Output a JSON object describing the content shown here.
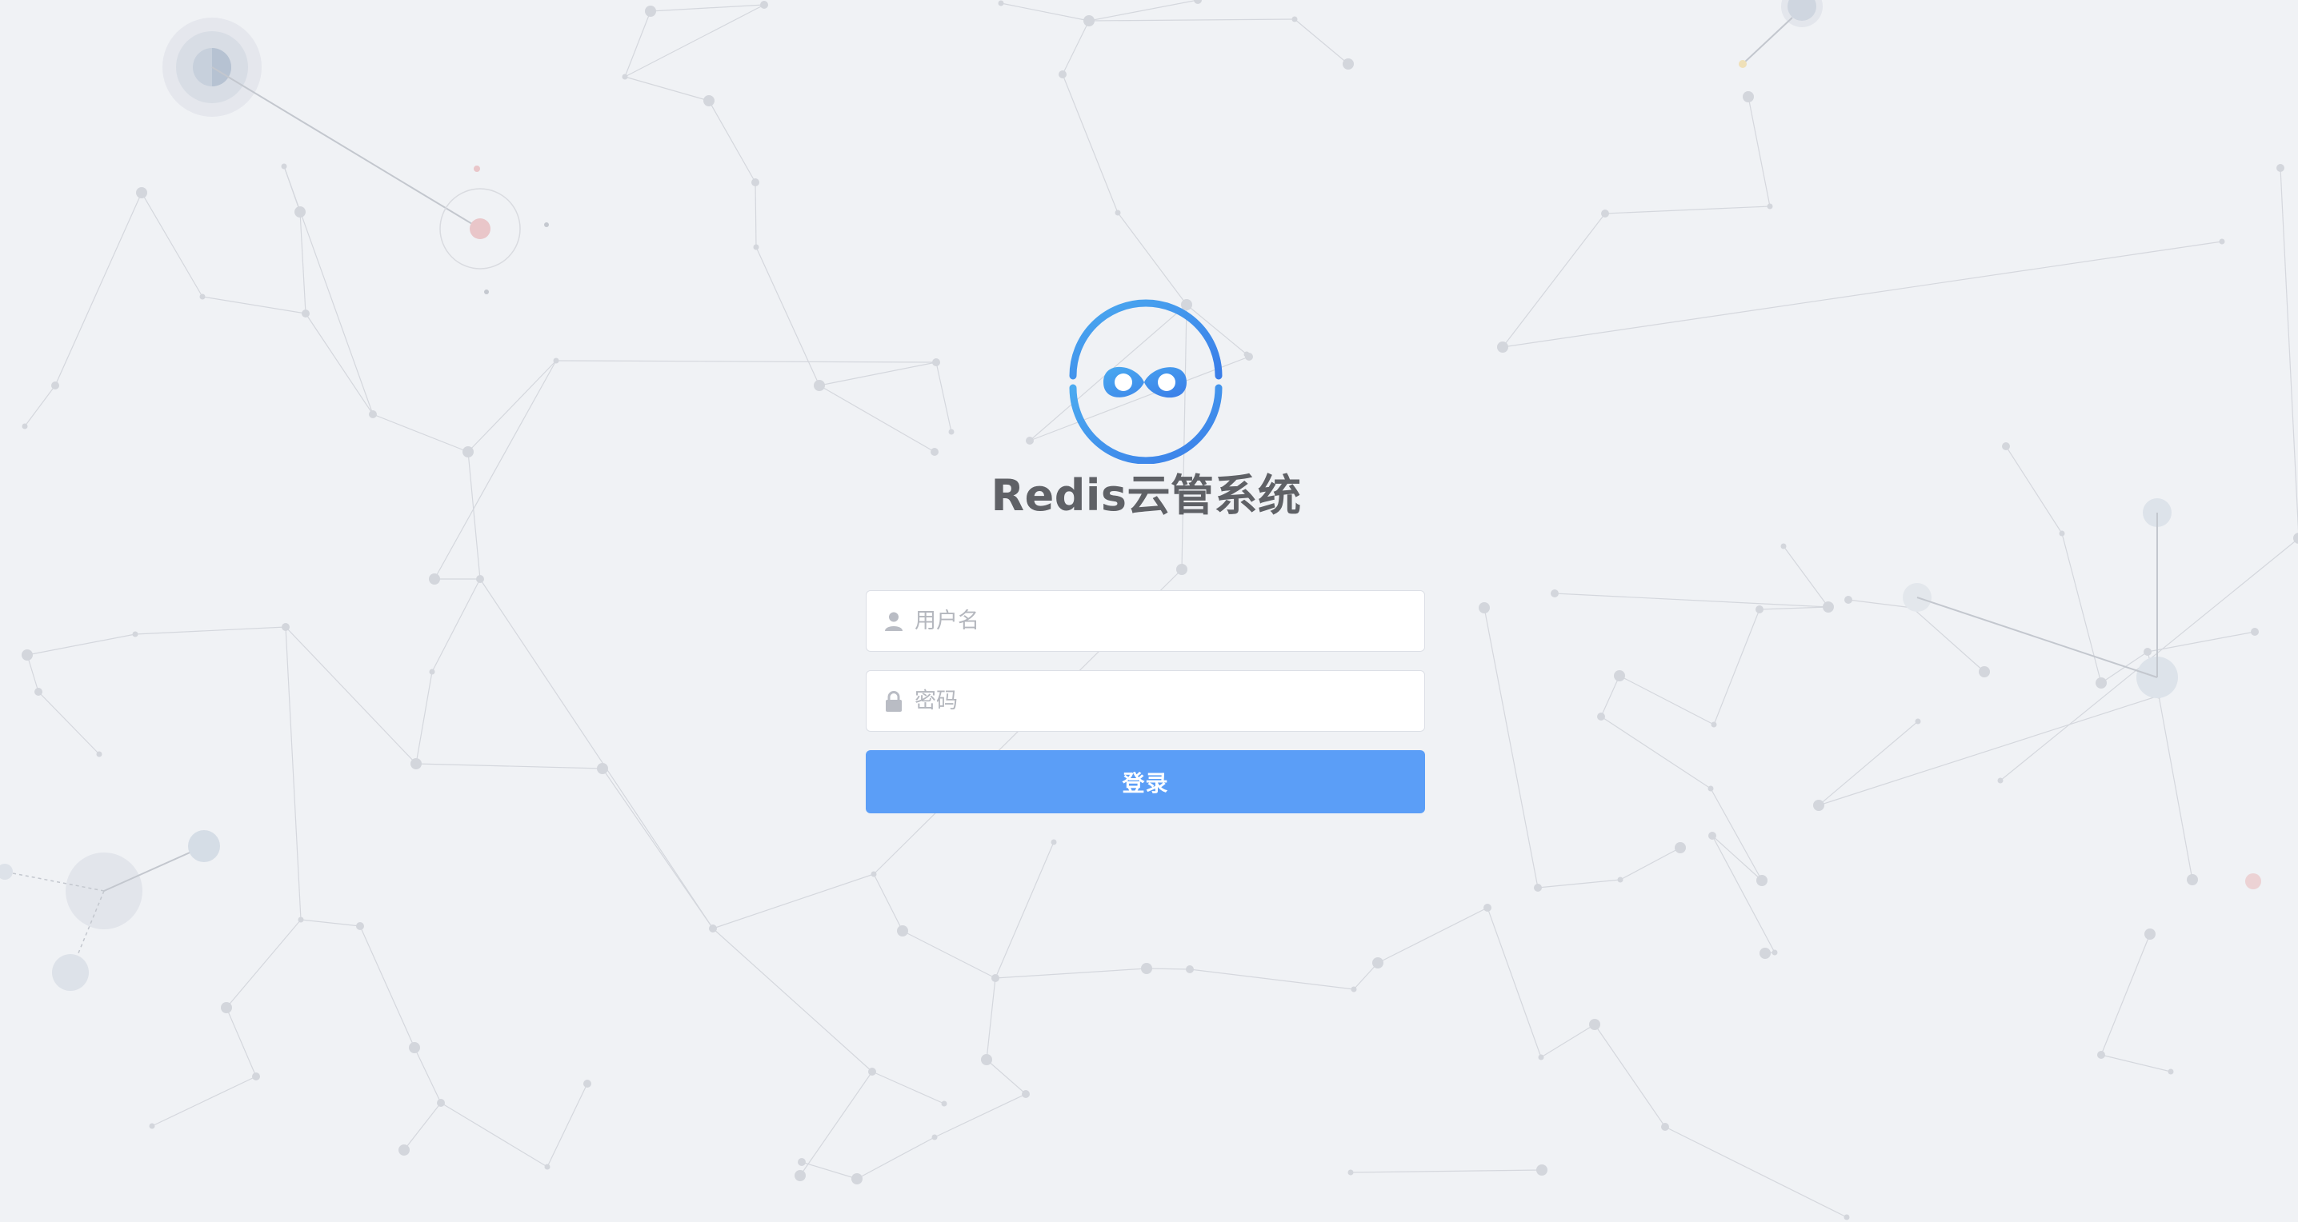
{
  "app": {
    "title": "Redis云管系统"
  },
  "login_form": {
    "username": {
      "placeholder": "用户名",
      "value": "",
      "icon": "user-icon"
    },
    "password": {
      "placeholder": "密码",
      "value": "",
      "icon": "lock-icon"
    },
    "submit_label": "登录"
  },
  "theme": {
    "background": "#f0f2f5",
    "primary_button": "#5b9ef7",
    "logo_gradient_start": "#4aaaf0",
    "logo_gradient_end": "#3a7de8",
    "title_color": "#5f6166",
    "icon_color": "#b9bcc4"
  }
}
